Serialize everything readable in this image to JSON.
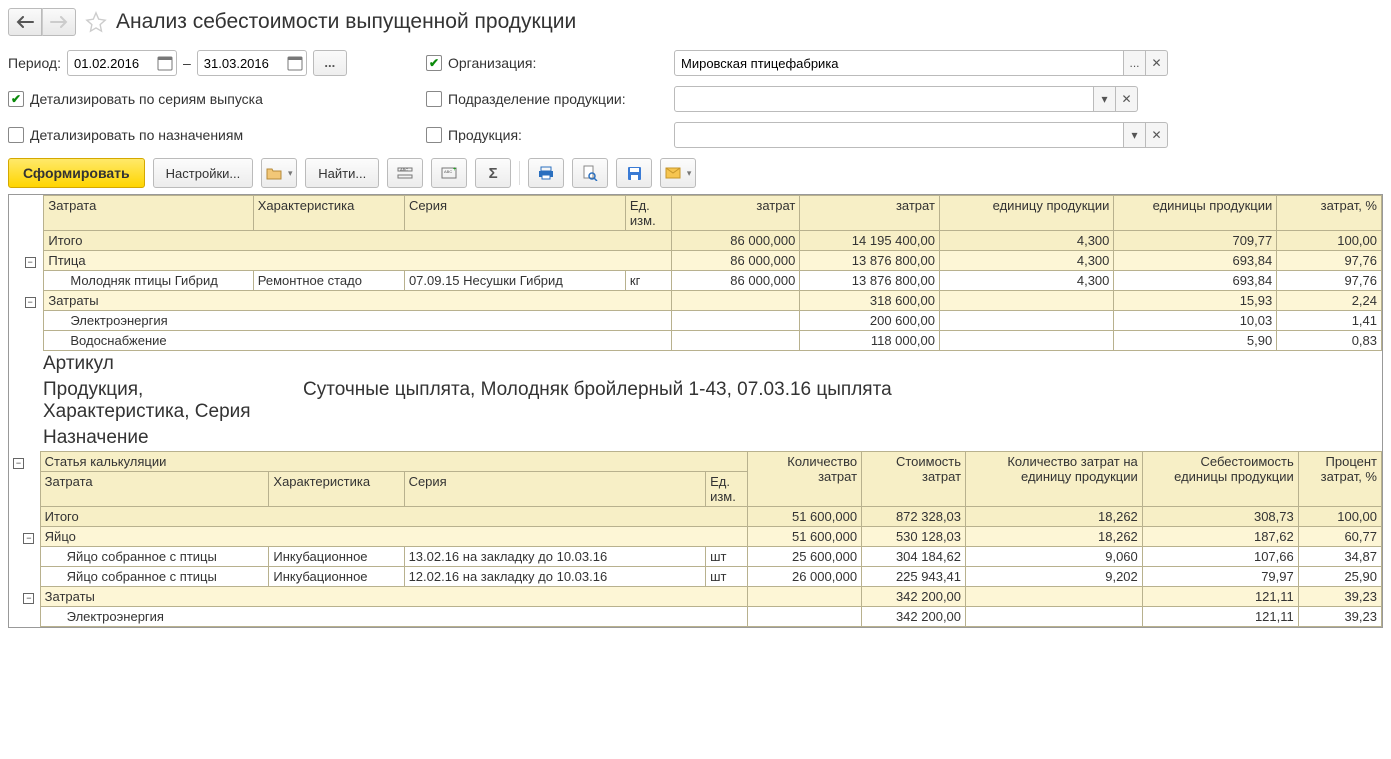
{
  "title": "Анализ себестоимости выпущенной продукции",
  "period": {
    "label": "Период:",
    "from": "01.02.2016",
    "to": "31.03.2016",
    "dash": "–"
  },
  "chk_series": {
    "checked": true,
    "label": "Детализировать по сериям выпуска"
  },
  "chk_purpose": {
    "checked": false,
    "label": "Детализировать по назначениям"
  },
  "flt_org": {
    "checked": true,
    "label": "Организация:",
    "value": "Мировская птицефабрика"
  },
  "flt_dept": {
    "checked": false,
    "label": "Подразделение продукции:",
    "value": ""
  },
  "flt_prod": {
    "checked": false,
    "label": "Продукция:",
    "value": ""
  },
  "toolbar": {
    "run": "Сформировать",
    "settings": "Настройки...",
    "find": "Найти..."
  },
  "headers": {
    "calc_item": "Статья калькуляции",
    "cost_name": "Затрата",
    "char": "Характеристика",
    "series": "Серия",
    "unit": "Ед. изм.",
    "qty": "затрат",
    "qty_full": "Количество затрат",
    "cost": "затрат",
    "cost_full": "Стоимость затрат",
    "qpu": "единицу продукции",
    "qpu_full": "Количество затрат на единицу продукции",
    "cpu": "единицы продукции",
    "cpu_full": "Себестоимость единицы продукции",
    "pct": "затрат, %",
    "pct_full": "Процент затрат, %"
  },
  "block1": {
    "total": {
      "name": "Итого",
      "qty": "86 000,000",
      "cost": "14 195 400,00",
      "qpu": "4,300",
      "cpu": "709,77",
      "pct": "100,00"
    },
    "g_bird": {
      "name": "Птица",
      "qty": "86 000,000",
      "cost": "13 876 800,00",
      "qpu": "4,300",
      "cpu": "693,84",
      "pct": "97,76"
    },
    "d_bird": {
      "name": "Молодняк птицы Гибрид",
      "char": "Ремонтное стадо",
      "ser": "07.09.15 Несушки Гибрид",
      "unit": "кг",
      "qty": "86 000,000",
      "cost": "13 876 800,00",
      "qpu": "4,300",
      "cpu": "693,84",
      "pct": "97,76"
    },
    "g_cost": {
      "name": "Затраты",
      "cost": "318 600,00",
      "cpu": "15,93",
      "pct": "2,24"
    },
    "d_elec": {
      "name": "Электроэнергия",
      "cost": "200 600,00",
      "cpu": "10,03",
      "pct": "1,41"
    },
    "d_water": {
      "name": "Водоснабжение",
      "cost": "118 000,00",
      "cpu": "5,90",
      "pct": "0,83"
    }
  },
  "section": {
    "article_lbl": "Артикул",
    "prod_lbl": "Продукция, Характеристика, Серия",
    "prod_val": "Суточные цыплята, Молодняк бройлерный 1-43, 07.03.16 цыплята",
    "purpose_lbl": "Назначение"
  },
  "block2": {
    "total": {
      "name": "Итого",
      "qty": "51 600,000",
      "cost": "872 328,03",
      "qpu": "18,262",
      "cpu": "308,73",
      "pct": "100,00"
    },
    "g_egg": {
      "name": "Яйцо",
      "qty": "51 600,000",
      "cost": "530 128,03",
      "qpu": "18,262",
      "cpu": "187,62",
      "pct": "60,77"
    },
    "d_egg1": {
      "name": "Яйцо собранное с птицы",
      "char": "Инкубационное",
      "ser": "13.02.16 на закладку до 10.03.16",
      "unit": "шт",
      "qty": "25 600,000",
      "cost": "304 184,62",
      "qpu": "9,060",
      "cpu": "107,66",
      "pct": "34,87"
    },
    "d_egg2": {
      "name": "Яйцо собранное с птицы",
      "char": "Инкубационное",
      "ser": "12.02.16 на закладку до 10.03.16",
      "unit": "шт",
      "qty": "26 000,000",
      "cost": "225 943,41",
      "qpu": "9,202",
      "cpu": "79,97",
      "pct": "25,90"
    },
    "g_cost": {
      "name": "Затраты",
      "cost": "342 200,00",
      "cpu": "121,11",
      "pct": "39,23"
    },
    "d_elec": {
      "name": "Электроэнергия",
      "cost": "342 200,00",
      "cpu": "121,11",
      "pct": "39,23"
    }
  }
}
